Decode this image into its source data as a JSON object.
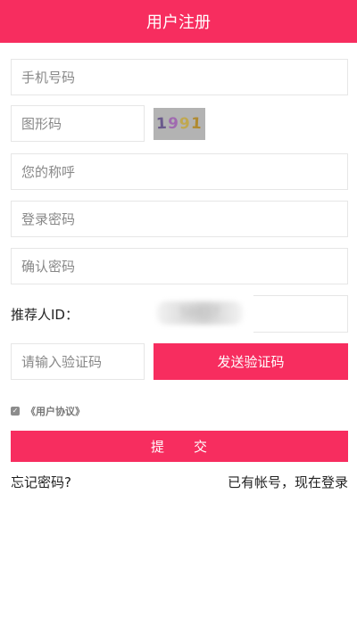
{
  "header": {
    "title": "用户注册",
    "background": "#f72d5f"
  },
  "form": {
    "phone_placeholder": "手机号码",
    "captcha_placeholder": "图形码",
    "captcha_text": [
      "1",
      "9",
      "9",
      "1"
    ],
    "captcha_colors": [
      "#6a5a8c",
      "#a06ab0",
      "#c0a850",
      "#b08a30"
    ],
    "nickname_placeholder": "您的称呼",
    "password_placeholder": "登录密码",
    "confirm_password_placeholder": "确认密码",
    "referrer_label": "推荐人ID：",
    "referrer_value": "58837",
    "sms_code_placeholder": "请输入验证码",
    "send_code_label": "发送验证码",
    "agreement_label": "《用户协议》",
    "agreement_checked": true,
    "submit_label": "提　　交"
  },
  "footer": {
    "forgot_label": "忘记密码?",
    "login_label": "已有帐号，现在登录"
  },
  "colors": {
    "accent": "#f72d5f",
    "border": "#e6e6e6",
    "placeholder": "#888888"
  },
  "icons": {
    "checkbox": "checkbox-checked-icon"
  }
}
